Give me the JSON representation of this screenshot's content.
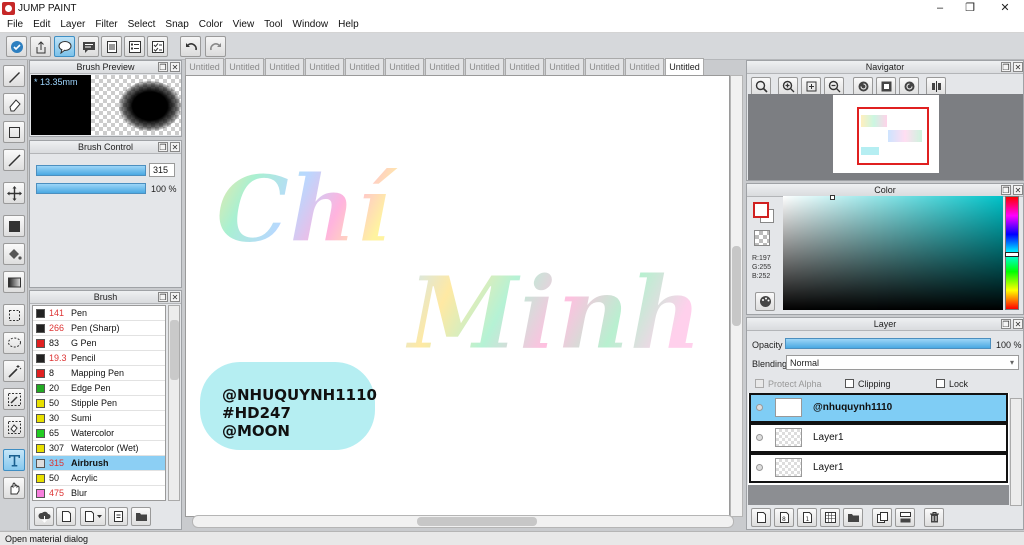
{
  "app": {
    "title": "JUMP PAINT",
    "window_buttons": [
      "–",
      "❐",
      "✕"
    ]
  },
  "menu": [
    "File",
    "Edit",
    "Layer",
    "Filter",
    "Select",
    "Snap",
    "Color",
    "View",
    "Tool",
    "Window",
    "Help"
  ],
  "toolbar_icons": [
    "check-circle-icon",
    "share-icon",
    "speech-bubble-icon",
    "comment-icon",
    "page-icon",
    "list-icon",
    "checklist-icon",
    "undo-icon",
    "redo-icon"
  ],
  "tool_icons": [
    "pen-tool-icon",
    "eraser-tool-icon",
    "rectangle-tool-icon",
    "line-tool-icon",
    "move-tool-icon",
    "fill-rect-tool-icon",
    "bucket-tool-icon",
    "gradient-tool-icon",
    "rect-select-icon",
    "lasso-select-icon",
    "magic-wand-icon",
    "select-pen-icon",
    "select-eraser-icon",
    "text-tool-icon",
    "hand-tool-icon"
  ],
  "brush_preview": {
    "title": "Brush Preview",
    "size": "* 13.35mm"
  },
  "brush_control": {
    "title": "Brush Control",
    "size_value": "315",
    "opacity_value": "100 %",
    "size_fill": 1.0,
    "opacity_fill": 1.0
  },
  "brush": {
    "title": "Brush",
    "items": [
      {
        "size": "141",
        "name": "Pen",
        "color": "#222222",
        "red": true
      },
      {
        "size": "266",
        "name": "Pen (Sharp)",
        "color": "#222222",
        "red": true
      },
      {
        "size": "83",
        "name": "G Pen",
        "color": "#e02020",
        "red": false
      },
      {
        "size": "19.3",
        "name": "Pencil",
        "color": "#222222",
        "red": true
      },
      {
        "size": "8",
        "name": "Mapping Pen",
        "color": "#e02020",
        "red": false
      },
      {
        "size": "20",
        "name": "Edge Pen",
        "color": "#22aa22",
        "red": false
      },
      {
        "size": "50",
        "name": "Stipple Pen",
        "color": "#e8e000",
        "red": false
      },
      {
        "size": "30",
        "name": "Sumi",
        "color": "#e8e000",
        "red": false
      },
      {
        "size": "65",
        "name": "Watercolor",
        "color": "#22cc22",
        "red": false
      },
      {
        "size": "307",
        "name": "Watercolor (Wet)",
        "color": "#e8e000",
        "red": false
      },
      {
        "size": "315",
        "name": "Airbrush",
        "color": "#dddddd",
        "red": true,
        "selected": true
      },
      {
        "size": "50",
        "name": "Acrylic",
        "color": "#e8e000",
        "red": false
      },
      {
        "size": "475",
        "name": "Blur",
        "color": "#f77fdd",
        "red": true
      }
    ]
  },
  "tabs": [
    "Untitled",
    "Untitled",
    "Untitled",
    "Untitled",
    "Untitled",
    "Untitled",
    "Untitled",
    "Untitled",
    "Untitled",
    "Untitled",
    "Untitled",
    "Untitled",
    "Untitled"
  ],
  "canvas": {
    "art_word_1": "Chí",
    "art_word_2": "Minh",
    "sticker_lines": [
      "@NHUQUYNH1110",
      "#HD247",
      "@MOON"
    ]
  },
  "navigator": {
    "title": "Navigator"
  },
  "color": {
    "title": "Color",
    "r": "R:197",
    "g": "G:255",
    "b": "B:252"
  },
  "layer": {
    "title": "Layer",
    "opacity_label": "Opacity",
    "opacity_value": "100 %",
    "blending_label": "Blending",
    "blending_value": "Normal",
    "protect_alpha": "Protect Alpha",
    "clipping": "Clipping",
    "lock": "Lock",
    "items": [
      {
        "name": "@nhuquynh1110",
        "selected": true
      },
      {
        "name": "Layer1",
        "selected": false
      },
      {
        "name": "Layer1",
        "selected": false
      }
    ]
  },
  "status": "Open material dialog"
}
